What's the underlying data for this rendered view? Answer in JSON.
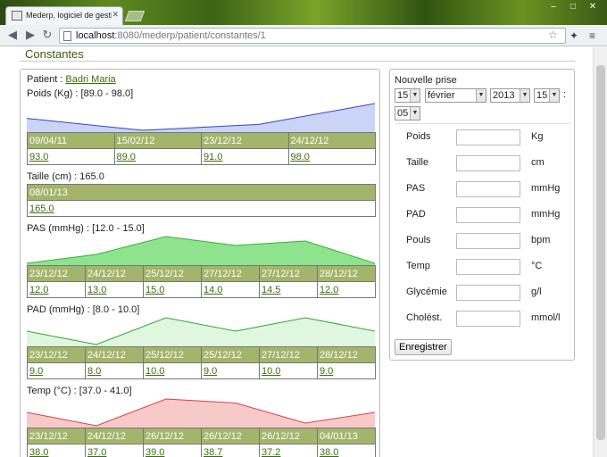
{
  "browser": {
    "tab_title": "Mederp, logiciel de gestion d",
    "url_host": "localhost",
    "url_rest": ":8080/mederp/patient/constantes/1"
  },
  "page": {
    "title": "Constantes",
    "patient_label": "Patient : ",
    "patient_name": "Badri Maria"
  },
  "constants": [
    {
      "label": "Poids (Kg) : [89.0 - 98.0]",
      "color": "#3344cc",
      "fill": "#c9d4f7",
      "dates": [
        "09/04/11",
        "15/02/12",
        "23/12/12",
        "24/12/12"
      ],
      "values": [
        "93.0",
        "89.0",
        "91.0",
        "98.0"
      ]
    },
    {
      "label": "Taille (cm) : 165.0",
      "color": "",
      "fill": "",
      "dates": [
        "08/01/13"
      ],
      "values": [
        "165.0"
      ]
    },
    {
      "label": "PAS (mmHg) : [12.0 - 15.0]",
      "color": "#2fb52f",
      "fill": "#8fe38f",
      "dates": [
        "23/12/12",
        "24/12/12",
        "25/12/12",
        "27/12/12",
        "27/12/12",
        "28/12/12"
      ],
      "values": [
        "12.0",
        "13.0",
        "15.0",
        "14.0",
        "14.5",
        "12.0"
      ]
    },
    {
      "label": "PAD (mmHg) : [8.0 - 10.0]",
      "color": "#2fa82f",
      "fill": "#dff7df",
      "dates": [
        "23/12/12",
        "24/12/12",
        "25/12/12",
        "25/12/12",
        "27/12/12",
        "28/12/12"
      ],
      "values": [
        "9.0",
        "8.0",
        "10.0",
        "9.0",
        "10.0",
        "9.0"
      ]
    },
    {
      "label": "Temp (°C) : [37.0 - 41.0]",
      "color": "#e04040",
      "fill": "#f7c9c9",
      "dates": [
        "23/12/12",
        "24/12/12",
        "26/12/12",
        "26/12/12",
        "26/12/12",
        "04/01/13"
      ],
      "values": [
        "38.0",
        "37.0",
        "39.0",
        "38.7",
        "37.2",
        "38.0"
      ]
    }
  ],
  "form": {
    "title": "Nouvelle prise",
    "day": "15",
    "month": "février",
    "year": "2013",
    "hour": "15",
    "colon": ":",
    "minute": "05",
    "fields": [
      {
        "label": "Poids",
        "unit": "Kg"
      },
      {
        "label": "Taille",
        "unit": "cm"
      },
      {
        "label": "PAS",
        "unit": "mmHg"
      },
      {
        "label": "PAD",
        "unit": "mmHg"
      },
      {
        "label": "Pouls",
        "unit": "bpm"
      },
      {
        "label": "Temp",
        "unit": "°C"
      },
      {
        "label": "Glycémie",
        "unit": "g/l"
      },
      {
        "label": "Cholést.",
        "unit": "mmol/l"
      }
    ],
    "save_label": "Enregistrer"
  }
}
